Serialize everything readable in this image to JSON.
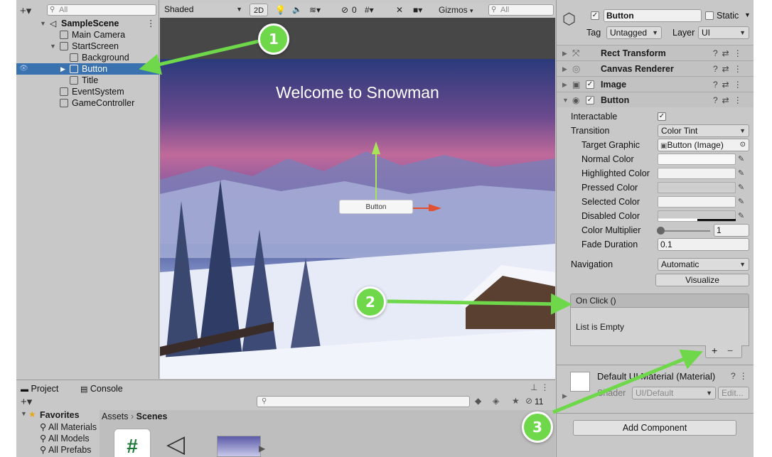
{
  "hierarchy": {
    "search_placeholder": "All",
    "items": [
      {
        "label": "SampleScene"
      },
      {
        "label": "Main Camera"
      },
      {
        "label": "StartScreen"
      },
      {
        "label": "Background"
      },
      {
        "label": "Button"
      },
      {
        "label": "Title"
      },
      {
        "label": "EventSystem"
      },
      {
        "label": "GameController"
      }
    ]
  },
  "scene": {
    "shading_mode": "Shaded",
    "mode_2d": "2D",
    "hidden_count": "0",
    "gizmos_label": "Gizmos",
    "search_placeholder": "All",
    "title_text": "Welcome to Snowman",
    "button_text": "Button"
  },
  "inspector": {
    "object_name": "Button",
    "static_label": "Static",
    "tag_label": "Tag",
    "tag_value": "Untagged",
    "layer_label": "Layer",
    "layer_value": "UI",
    "components": {
      "rect_transform": "Rect Transform",
      "canvas_renderer": "Canvas Renderer",
      "image": "Image",
      "button": "Button"
    },
    "fields": {
      "interactable": "Interactable",
      "transition": "Transition",
      "transition_value": "Color Tint",
      "target_graphic": "Target Graphic",
      "target_graphic_value": "Button (Image)",
      "normal_color": "Normal Color",
      "highlighted_color": "Highlighted Color",
      "pressed_color": "Pressed Color",
      "selected_color": "Selected Color",
      "disabled_color": "Disabled Color",
      "color_multiplier": "Color Multiplier",
      "color_multiplier_value": "1",
      "fade_duration": "Fade Duration",
      "fade_duration_value": "0.1",
      "navigation": "Navigation",
      "navigation_value": "Automatic",
      "visualize": "Visualize"
    },
    "on_click": {
      "header": "On Click ()",
      "empty_text": "List is Empty",
      "add": "+",
      "remove": "−"
    },
    "material": {
      "name": "Default UI Material (Material)",
      "shader_label": "Shader",
      "shader_value": "UI/Default",
      "edit": "Edit..."
    },
    "add_component": "Add Component"
  },
  "project": {
    "tabs": [
      "Project",
      "Console"
    ],
    "hidden_count": "11",
    "favorites_label": "Favorites",
    "favorites": [
      "All Materials",
      "All Models",
      "All Prefabs"
    ],
    "breadcrumb": [
      "Assets",
      "Scenes"
    ]
  },
  "callouts": [
    "1",
    "2",
    "3"
  ],
  "colors": {
    "selection": "#3a72b0",
    "callout": "#6ed84a",
    "panel": "#c8c8c8"
  }
}
